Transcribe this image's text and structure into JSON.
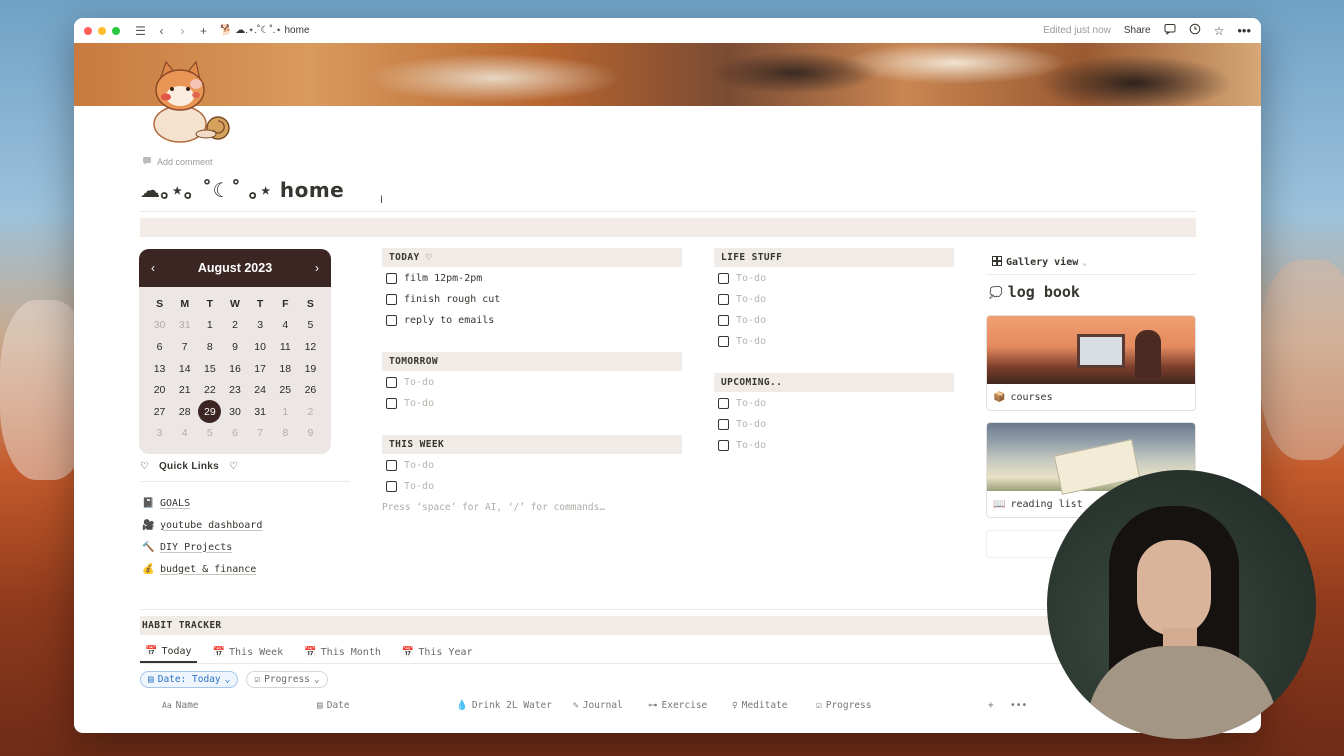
{
  "titlebar": {
    "page_title": "🐕 ☁︎.⋆.˚☾˚.⋆ home",
    "edited_status": "Edited just now",
    "share_label": "Share"
  },
  "page": {
    "add_comment": "Add comment",
    "title": "☁︎｡⋆｡ ˚☾˚ ｡⋆ home"
  },
  "calendar": {
    "month": "August 2023",
    "prev": "‹",
    "next": "›",
    "weekdays": [
      "S",
      "M",
      "T",
      "W",
      "T",
      "F",
      "S"
    ],
    "days": [
      {
        "d": "30",
        "m": true
      },
      {
        "d": "31",
        "m": true
      },
      {
        "d": "1"
      },
      {
        "d": "2"
      },
      {
        "d": "3"
      },
      {
        "d": "4"
      },
      {
        "d": "5"
      },
      {
        "d": "6"
      },
      {
        "d": "7"
      },
      {
        "d": "8"
      },
      {
        "d": "9"
      },
      {
        "d": "10"
      },
      {
        "d": "11"
      },
      {
        "d": "12"
      },
      {
        "d": "13"
      },
      {
        "d": "14"
      },
      {
        "d": "15"
      },
      {
        "d": "16"
      },
      {
        "d": "17"
      },
      {
        "d": "18"
      },
      {
        "d": "19"
      },
      {
        "d": "20"
      },
      {
        "d": "21"
      },
      {
        "d": "22"
      },
      {
        "d": "23"
      },
      {
        "d": "24"
      },
      {
        "d": "25"
      },
      {
        "d": "26"
      },
      {
        "d": "27"
      },
      {
        "d": "28"
      },
      {
        "d": "29",
        "sel": true
      },
      {
        "d": "30"
      },
      {
        "d": "31"
      },
      {
        "d": "1",
        "m": true
      },
      {
        "d": "2",
        "m": true
      },
      {
        "d": "3",
        "m": true
      },
      {
        "d": "4",
        "m": true
      },
      {
        "d": "5",
        "m": true
      },
      {
        "d": "6",
        "m": true
      },
      {
        "d": "7",
        "m": true
      },
      {
        "d": "8",
        "m": true
      },
      {
        "d": "9",
        "m": true
      }
    ]
  },
  "quick_links": {
    "heart": "♡",
    "title": "Quick Links",
    "items": [
      {
        "icon": "📓",
        "label": "GOALS"
      },
      {
        "icon": "🎥",
        "label": "youtube dashboard"
      },
      {
        "icon": "🔨",
        "label": "DIY Projects"
      },
      {
        "icon": "💰",
        "label": "budget & finance"
      }
    ]
  },
  "todos": {
    "today": {
      "title": "TODAY ♡",
      "items": [
        "film 12pm-2pm",
        "finish rough cut",
        "reply to emails"
      ]
    },
    "tomorrow": {
      "title": "TOMORROW",
      "items": [
        "To-do",
        "To-do"
      ]
    },
    "this_week": {
      "title": "THIS WEEK",
      "items": [
        "To-do",
        "To-do"
      ]
    },
    "life_stuff": {
      "title": "LIFE STUFF",
      "items": [
        "To-do",
        "To-do",
        "To-do",
        "To-do"
      ]
    },
    "upcoming": {
      "title": "UPCOMING..",
      "items": [
        "To-do",
        "To-do",
        "To-do"
      ]
    },
    "hint": "Press ‘space’ for AI, ‘/’ for commands…"
  },
  "gallery": {
    "view_label": "Gallery view",
    "title": "log book",
    "cards": [
      {
        "icon": "📦",
        "label": "courses"
      },
      {
        "icon": "📖",
        "label": "reading list"
      }
    ]
  },
  "habit_tracker": {
    "title": "HABIT TRACKER",
    "tabs": [
      "Today",
      "This Week",
      "This Month",
      "This Year"
    ],
    "filters": [
      "Date: Today",
      "Progress"
    ],
    "columns": [
      "Name",
      "Date",
      "Drink 2L Water",
      "Journal",
      "Exercise",
      "Meditate",
      "Progress"
    ],
    "name_prefix": "Aa"
  },
  "colors": {
    "accent_dark": "#3b2623",
    "text": "#37352f",
    "section_bg": "#f1ebe7",
    "filter_blue": "#2a73c8"
  }
}
